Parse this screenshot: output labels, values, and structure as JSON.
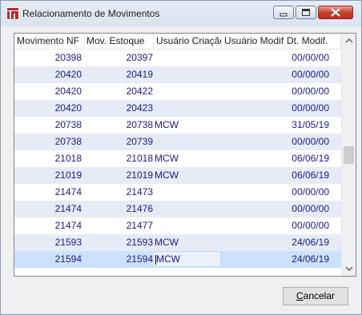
{
  "window": {
    "title": "Relacionamento de Movimentos"
  },
  "grid": {
    "columns": [
      "Movimento NF",
      "Mov. Estoque",
      "Usuário Criação",
      "Usuário Modif.",
      "Dt. Modif."
    ],
    "rows": [
      {
        "nf": "20398",
        "estoque": "20397",
        "criacao": "",
        "modif": "",
        "dt": "00/00/00"
      },
      {
        "nf": "20420",
        "estoque": "20419",
        "criacao": "",
        "modif": "",
        "dt": "00/00/00"
      },
      {
        "nf": "20420",
        "estoque": "20422",
        "criacao": "",
        "modif": "",
        "dt": "00/00/00"
      },
      {
        "nf": "20420",
        "estoque": "20423",
        "criacao": "",
        "modif": "",
        "dt": "00/00/00"
      },
      {
        "nf": "20738",
        "estoque": "20738",
        "criacao": "MCW",
        "modif": "",
        "dt": "31/05/19"
      },
      {
        "nf": "20738",
        "estoque": "20739",
        "criacao": "",
        "modif": "",
        "dt": "00/00/00"
      },
      {
        "nf": "21018",
        "estoque": "21018",
        "criacao": "MCW",
        "modif": "",
        "dt": "06/06/19"
      },
      {
        "nf": "21019",
        "estoque": "21019",
        "criacao": "MCW",
        "modif": "",
        "dt": "06/06/19"
      },
      {
        "nf": "21474",
        "estoque": "21473",
        "criacao": "",
        "modif": "",
        "dt": "00/00/00"
      },
      {
        "nf": "21474",
        "estoque": "21476",
        "criacao": "",
        "modif": "",
        "dt": "00/00/00"
      },
      {
        "nf": "21474",
        "estoque": "21477",
        "criacao": "",
        "modif": "",
        "dt": "00/00/00"
      },
      {
        "nf": "21593",
        "estoque": "21593",
        "criacao": "MCW",
        "modif": "",
        "dt": "24/06/19"
      },
      {
        "nf": "21594",
        "estoque": "21594",
        "criacao": "MCW",
        "modif": "",
        "dt": "24/06/19"
      }
    ],
    "selected_row": 12
  },
  "buttons": {
    "cancel_prefix": "",
    "cancel_underlined": "C",
    "cancel_rest": "ancelar"
  },
  "icons": {
    "app": "app-logo-icon",
    "minimize": "minimize-icon",
    "maximize": "maximize-icon",
    "close": "close-icon",
    "scroll_up": "chevron-up-icon",
    "scroll_down": "chevron-down-icon"
  },
  "colors": {
    "cell_text": "#19198c",
    "alt_row": "#e6ebf6",
    "selected_row": "#cce2fb",
    "close_button": "#c7412e"
  }
}
